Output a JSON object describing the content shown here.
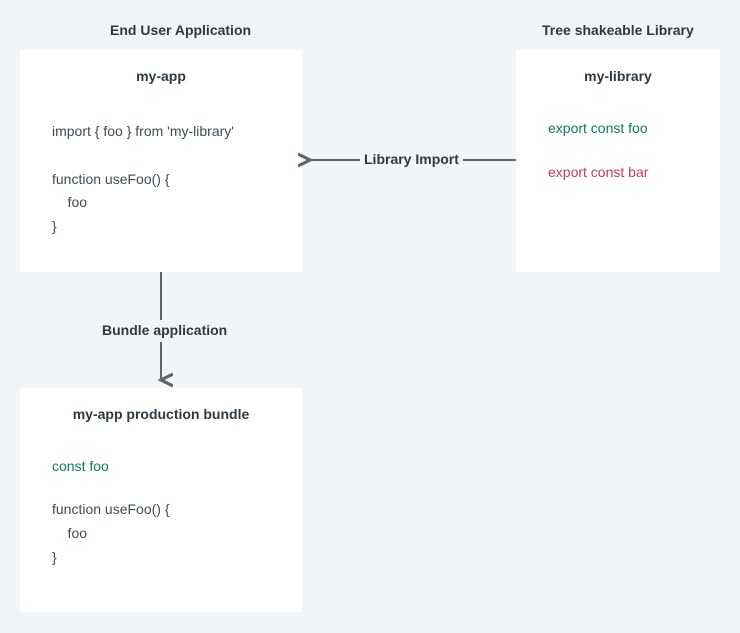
{
  "left_section_title": "End User Application",
  "right_section_title": "Tree shakeable Library",
  "app_box": {
    "title": "my-app",
    "code": "import { foo } from 'my-library'\n\nfunction useFoo() {\n    foo\n}"
  },
  "library_box": {
    "title": "my-library",
    "export_used": "export const foo",
    "export_unused": "export const bar"
  },
  "bundle_box": {
    "title": "my-app production bundle",
    "const_included": "const foo",
    "code": "function useFoo() {\n    foo\n}"
  },
  "arrows": {
    "import_label": "Library Import",
    "bundle_label": "Bundle application"
  }
}
